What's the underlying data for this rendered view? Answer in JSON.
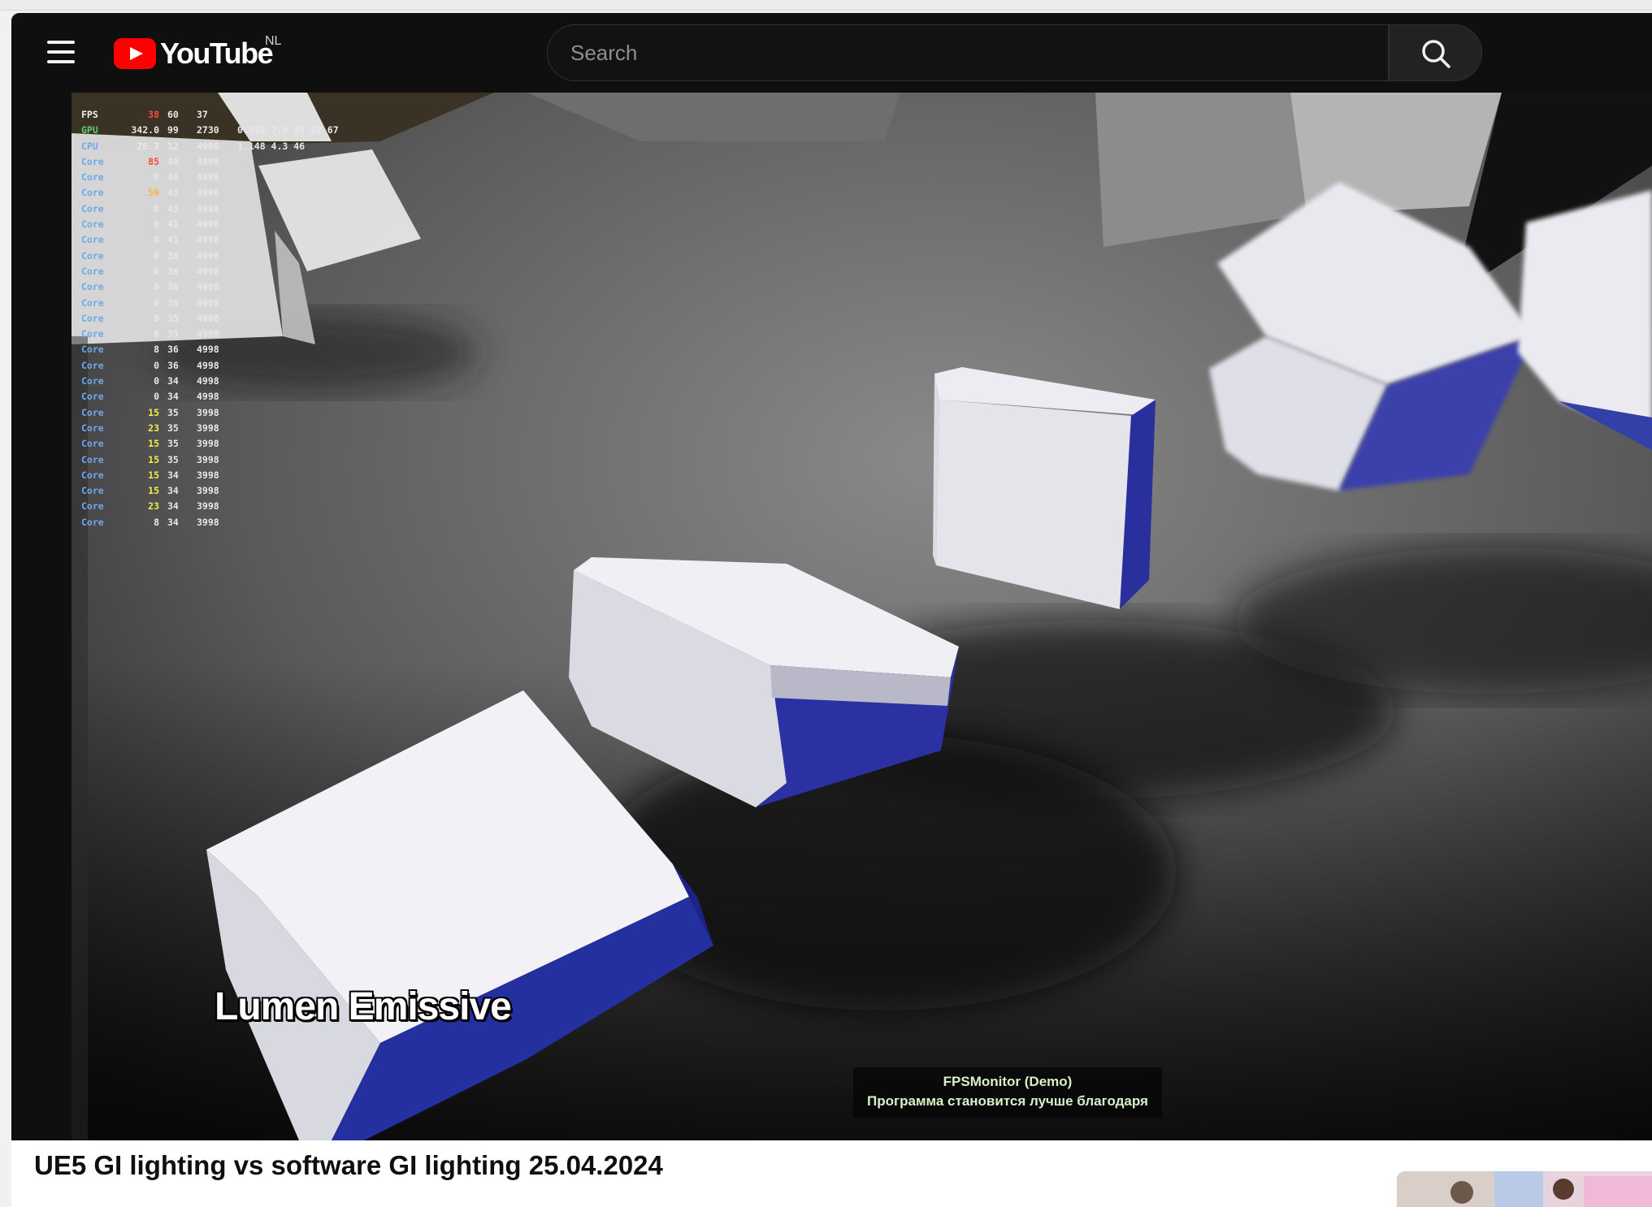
{
  "header": {
    "logo_text": "YouTube",
    "country_code": "NL",
    "search_placeholder": "Search"
  },
  "player": {
    "caption": "Lumen Emissive",
    "watermark_line1": "FPSMonitor (Demo)",
    "watermark_line2": "Программа становится лучше благодаря",
    "overlay": {
      "fps": {
        "label": "FPS",
        "current": "38",
        "avg": "60",
        "low": "37"
      },
      "gpu": {
        "label": "GPU",
        "power": "342.0",
        "load": "99",
        "clock": "2730",
        "rest": "0.950  7.0  58  52  67"
      },
      "cpu": {
        "label": "CPU",
        "power": "26.7",
        "load": "12",
        "clock": "4998",
        "rest": "1.148  4.3  46"
      },
      "cores": [
        {
          "label": "Core",
          "load": "85",
          "temp": "46",
          "clock": "4998",
          "heat": "hot"
        },
        {
          "label": "Core",
          "load": "0",
          "temp": "46",
          "clock": "4998",
          "heat": ""
        },
        {
          "label": "Core",
          "load": "50",
          "temp": "43",
          "clock": "4998",
          "heat": "warm"
        },
        {
          "label": "Core",
          "load": "0",
          "temp": "43",
          "clock": "4998",
          "heat": ""
        },
        {
          "label": "Core",
          "load": "0",
          "temp": "41",
          "clock": "4998",
          "heat": ""
        },
        {
          "label": "Core",
          "load": "0",
          "temp": "41",
          "clock": "4998",
          "heat": ""
        },
        {
          "label": "Core",
          "load": "0",
          "temp": "36",
          "clock": "4998",
          "heat": ""
        },
        {
          "label": "Core",
          "load": "0",
          "temp": "36",
          "clock": "4998",
          "heat": ""
        },
        {
          "label": "Core",
          "load": "0",
          "temp": "36",
          "clock": "4998",
          "heat": ""
        },
        {
          "label": "Core",
          "load": "0",
          "temp": "36",
          "clock": "4998",
          "heat": ""
        },
        {
          "label": "Core",
          "load": "0",
          "temp": "35",
          "clock": "4998",
          "heat": ""
        },
        {
          "label": "Core",
          "load": "0",
          "temp": "35",
          "clock": "4998",
          "heat": ""
        },
        {
          "label": "Core",
          "load": "8",
          "temp": "36",
          "clock": "4998",
          "heat": ""
        },
        {
          "label": "Core",
          "load": "0",
          "temp": "36",
          "clock": "4998",
          "heat": ""
        },
        {
          "label": "Core",
          "load": "0",
          "temp": "34",
          "clock": "4998",
          "heat": ""
        },
        {
          "label": "Core",
          "load": "0",
          "temp": "34",
          "clock": "4998",
          "heat": ""
        },
        {
          "label": "Core",
          "load": "15",
          "temp": "35",
          "clock": "3998",
          "heat": "yel"
        },
        {
          "label": "Core",
          "load": "23",
          "temp": "35",
          "clock": "3998",
          "heat": "yel"
        },
        {
          "label": "Core",
          "load": "15",
          "temp": "35",
          "clock": "3998",
          "heat": "yel"
        },
        {
          "label": "Core",
          "load": "15",
          "temp": "35",
          "clock": "3998",
          "heat": "yel"
        },
        {
          "label": "Core",
          "load": "15",
          "temp": "34",
          "clock": "3998",
          "heat": "yel"
        },
        {
          "label": "Core",
          "load": "15",
          "temp": "34",
          "clock": "3998",
          "heat": "yel"
        },
        {
          "label": "Core",
          "load": "23",
          "temp": "34",
          "clock": "3998",
          "heat": "yel"
        },
        {
          "label": "Core",
          "load": "8",
          "temp": "34",
          "clock": "3998",
          "heat": ""
        }
      ]
    }
  },
  "video": {
    "title": "UE5 GI lighting vs software GI lighting 25.04.2024"
  },
  "colors": {
    "brand_red": "#ff0000",
    "header_bg": "#0f0f0f",
    "box_blue": "#2a2f9e"
  },
  "icons": {
    "menu": "hamburger-menu-icon",
    "search": "search-icon",
    "logo": "youtube-play-icon"
  }
}
